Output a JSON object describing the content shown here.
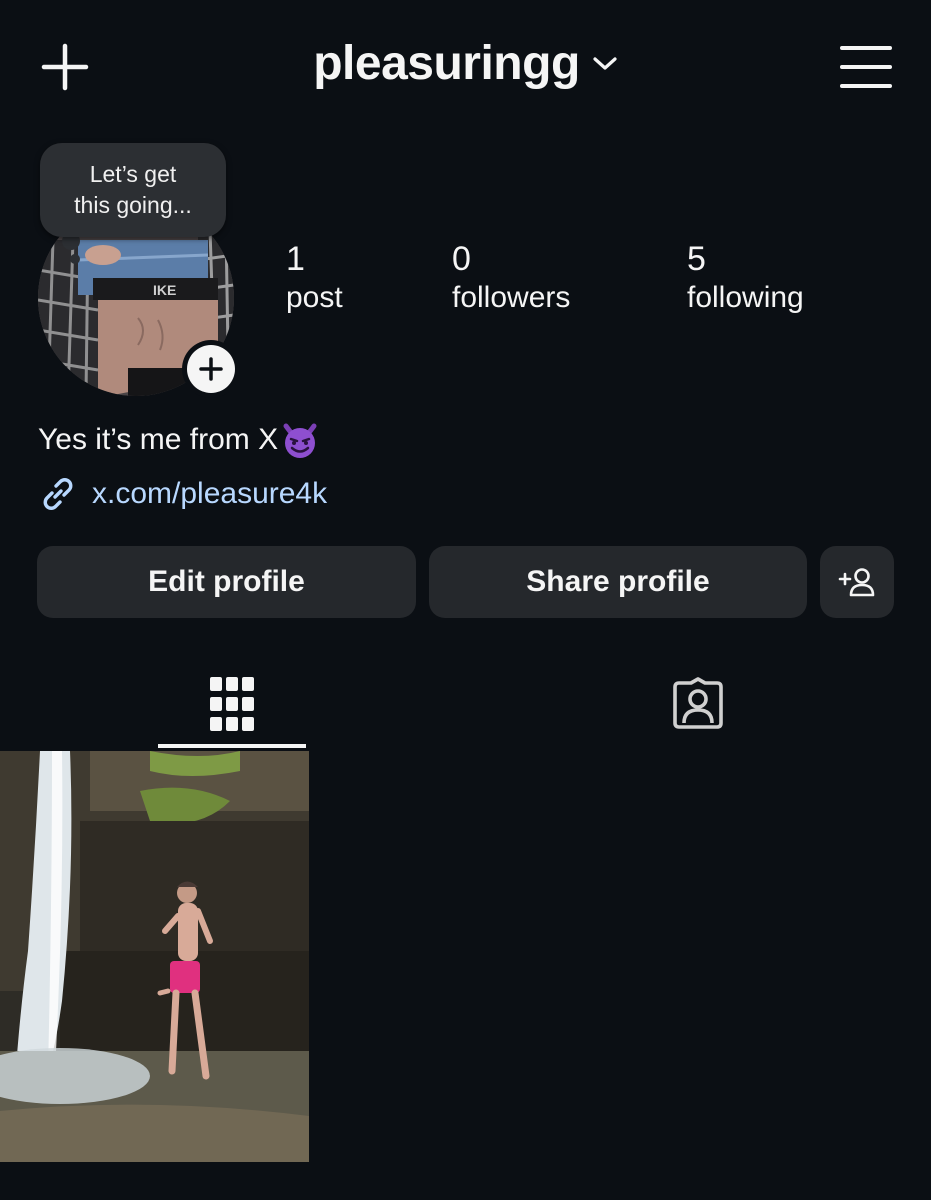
{
  "header": {
    "username": "pleasuringg",
    "create_icon": "plus-icon",
    "switch_icon": "chevron-down-icon",
    "menu_icon": "hamburger-menu-icon"
  },
  "note": {
    "text_line1": "Let’s get",
    "text_line2": "this going..."
  },
  "stats": [
    {
      "value": "1",
      "label": "post"
    },
    {
      "value": "0",
      "label": "followers"
    },
    {
      "value": "5",
      "label": "following"
    }
  ],
  "bio": {
    "text": "Yes it’s me from X",
    "emoji": "smiling-imp-emoji",
    "link": "x.com/pleasure4k"
  },
  "buttons": {
    "edit": "Edit profile",
    "share": "Share profile",
    "discover_icon": "add-person-icon"
  },
  "tabs": {
    "grid_icon": "grid-icon",
    "tagged_icon": "tagged-person-icon"
  },
  "colors": {
    "background": "#0b0f14",
    "button_bg": "#25282c",
    "link": "#b8d8ff"
  }
}
